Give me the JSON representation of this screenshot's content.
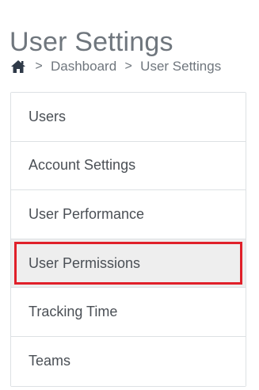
{
  "page": {
    "title": "User Settings"
  },
  "breadcrumb": {
    "home_icon": "home-icon",
    "separator": ">",
    "items": [
      {
        "label": "Dashboard"
      },
      {
        "label": "User Settings"
      }
    ]
  },
  "menu": {
    "active_index": 3,
    "highlight_color": "#e0202a",
    "items": [
      {
        "label": "Users"
      },
      {
        "label": "Account Settings"
      },
      {
        "label": "User Performance"
      },
      {
        "label": "User Permissions"
      },
      {
        "label": "Tracking Time"
      },
      {
        "label": "Teams"
      }
    ]
  }
}
